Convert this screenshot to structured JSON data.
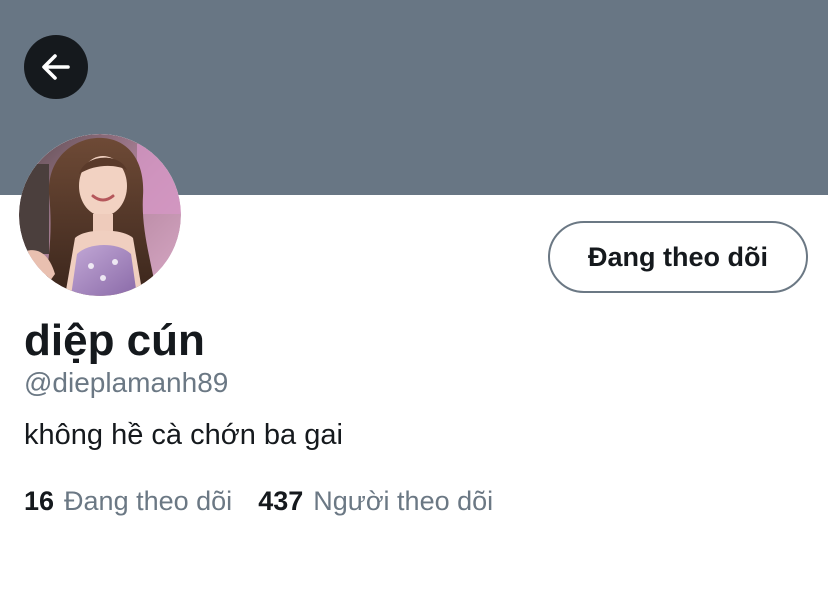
{
  "colors": {
    "banner": "#687684",
    "back_button_bg": "#15191d",
    "text_primary": "#15191d",
    "text_secondary": "#6b7884",
    "button_border": "#6b7884"
  },
  "header": {
    "back_icon": "arrow-left-icon"
  },
  "profile": {
    "avatar": "profile-photo",
    "display_name": "diệp cún",
    "handle": "@dieplamanh89",
    "bio": "không hề cà chớn ba gai",
    "follow_button_label": "Đang theo dõi",
    "following_count": "16",
    "following_label": "Đang theo dõi",
    "followers_count": "437",
    "followers_label": "Người theo dõi"
  }
}
